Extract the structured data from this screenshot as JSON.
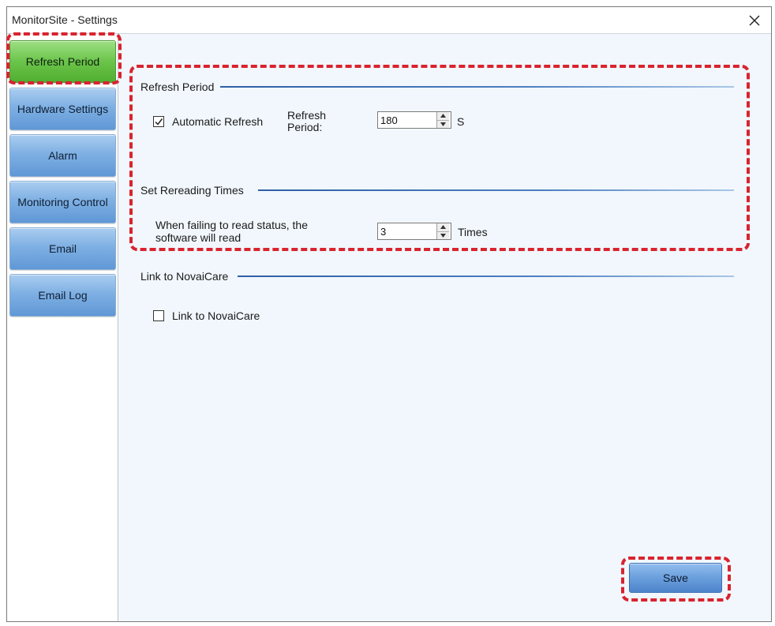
{
  "window": {
    "title": "MonitorSite - Settings"
  },
  "sidebar": {
    "items": [
      {
        "label": "Refresh Period",
        "active": true
      },
      {
        "label": "Hardware Settings",
        "active": false
      },
      {
        "label": "Alarm",
        "active": false
      },
      {
        "label": "Monitoring Control",
        "active": false
      },
      {
        "label": "Email",
        "active": false
      },
      {
        "label": "Email Log",
        "active": false
      }
    ]
  },
  "refresh_period": {
    "section_title": "Refresh Period",
    "auto_refresh_label": "Automatic Refresh",
    "auto_refresh_checked": true,
    "period_label_line1": "Refresh",
    "period_label_line2": "Period:",
    "period_value": "180",
    "period_unit": "S"
  },
  "rereading": {
    "section_title": "Set Rereading Times",
    "description_line1": "When failing to read status, the",
    "description_line2": "software will read",
    "times_value": "3",
    "times_unit": "Times"
  },
  "novaicare": {
    "section_title": "Link to NovaiCare",
    "checkbox_label": "Link to NovaiCare",
    "checked": false
  },
  "footer": {
    "save_label": "Save"
  },
  "colors": {
    "active_nav": "#6bc44a",
    "nav": "#7fb0e3",
    "highlight": "#d9232f"
  }
}
